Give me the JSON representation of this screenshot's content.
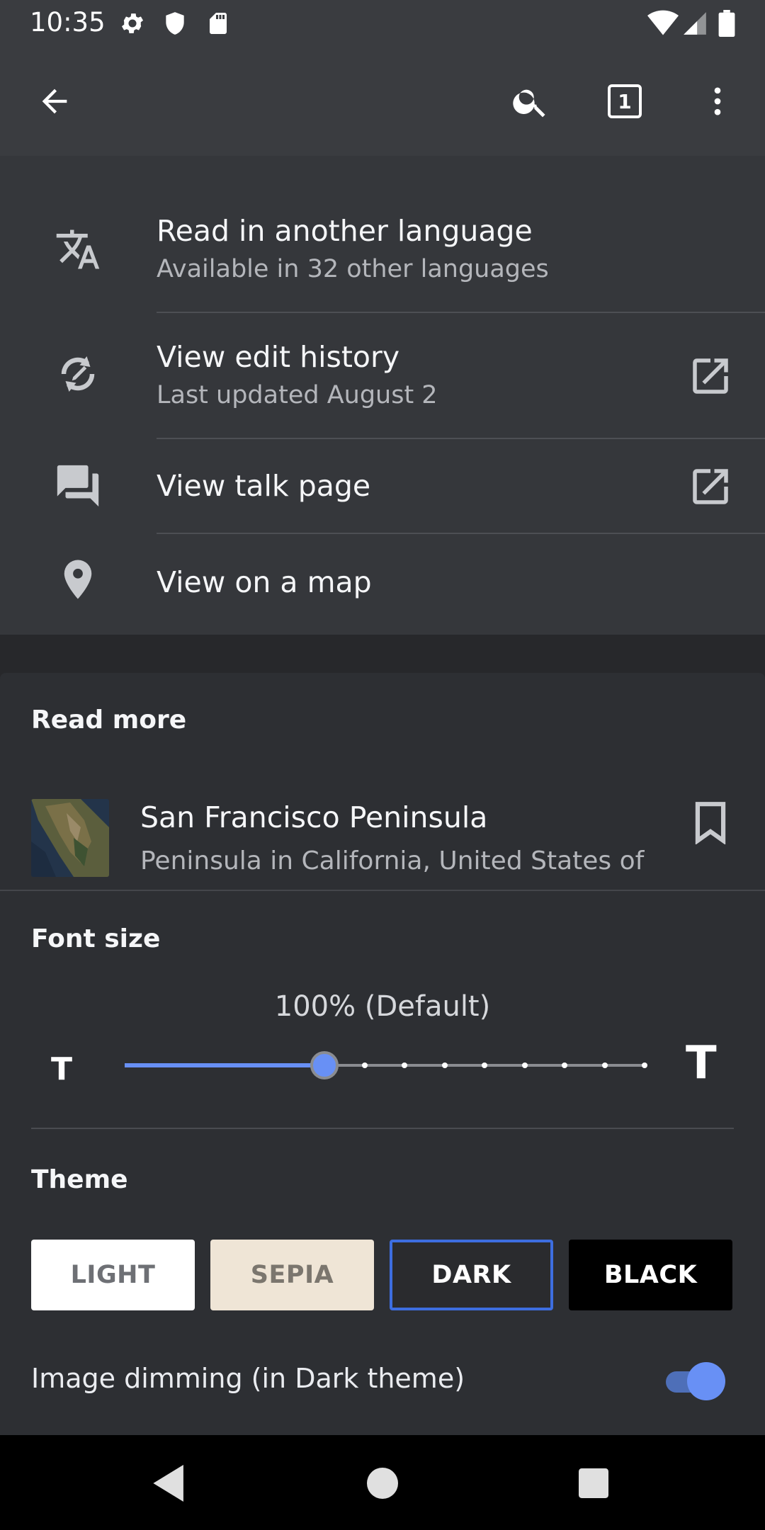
{
  "status_bar": {
    "time": "10:35",
    "left_icons": [
      "gear-icon",
      "shield-icon",
      "sd-card-icon"
    ],
    "right_icons": [
      "wifi-icon",
      "cell-signal-icon",
      "battery-icon"
    ]
  },
  "toolbar": {
    "back_icon": "arrow-back-icon",
    "search_icon": "search-icon",
    "tabs_count": "1",
    "overflow_icon": "more-vert-icon"
  },
  "menu": {
    "items": [
      {
        "title": "Read in another language",
        "subtitle": "Available in 32 other languages",
        "icon": "translate-icon"
      },
      {
        "title": "View edit history",
        "subtitle": "Last updated August 2",
        "icon": "edit-history-icon",
        "external": true
      },
      {
        "title": "View talk page",
        "icon": "talk-icon",
        "external": true
      },
      {
        "title": "View on a map",
        "icon": "map-pin-icon"
      }
    ]
  },
  "read_more": {
    "heading": "Read more",
    "article": {
      "title": "San Francisco Peninsula",
      "description": "Peninsula in California, United States of"
    }
  },
  "font_size": {
    "heading": "Font size",
    "value_label": "100% (Default)",
    "small_glyph": "T",
    "large_glyph": "T",
    "slider_steps": 14,
    "slider_index": 5
  },
  "theme": {
    "heading": "Theme",
    "options": [
      "LIGHT",
      "SEPIA",
      "DARK",
      "BLACK"
    ],
    "selected": "DARK"
  },
  "image_dimming": {
    "label": "Image dimming (in Dark theme)",
    "enabled": true
  },
  "colors": {
    "accent": "#6890f5",
    "selected_border": "#3d6ee0",
    "background": "#27282b",
    "card": "#35373b"
  }
}
